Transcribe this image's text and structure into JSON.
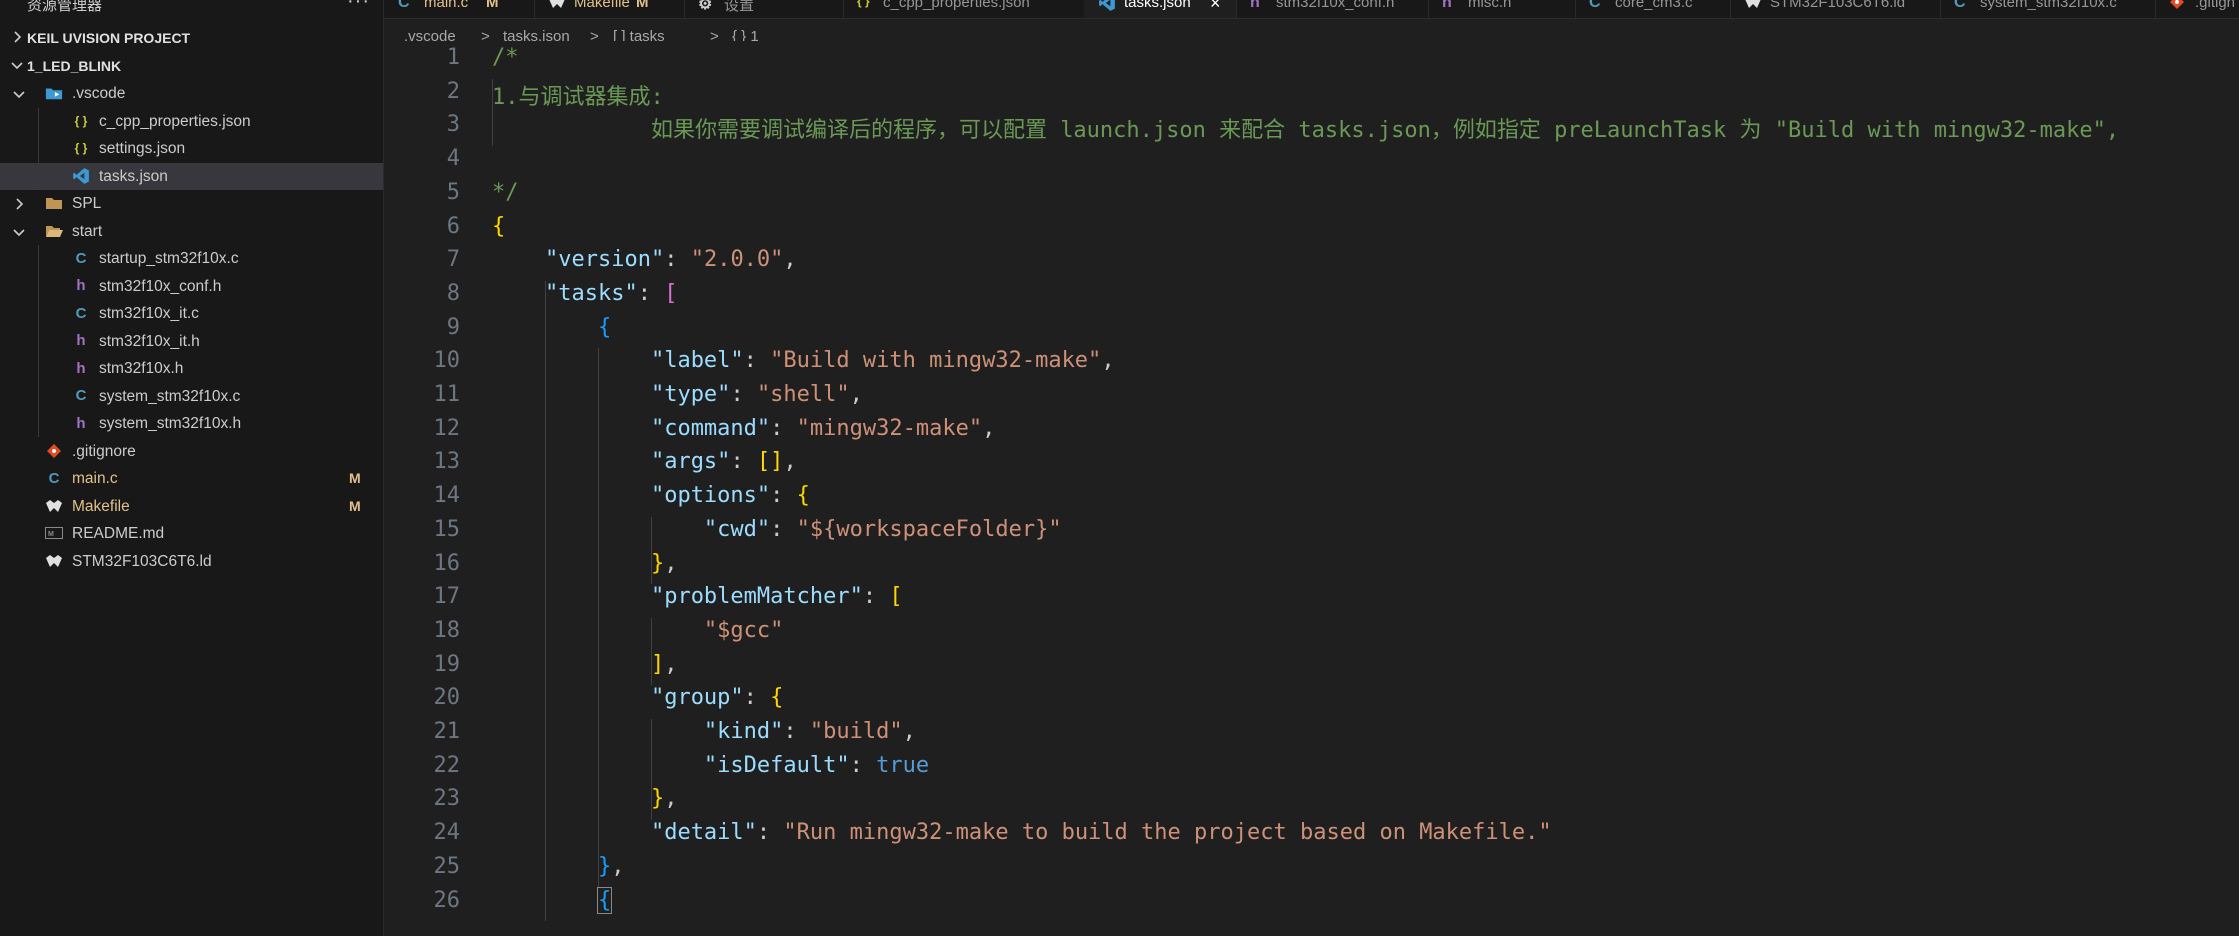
{
  "sidebar": {
    "header": "资源管理器",
    "more": "···",
    "section_collapsed": "KEIL UVISION PROJECT",
    "section_open": "1_LED_BLINK",
    "items": [
      {
        "label": ".vscode",
        "icon": "vscode-folder-icon",
        "depth": 1,
        "chev": "down"
      },
      {
        "label": "c_cpp_properties.json",
        "icon": "json-icon",
        "depth": 2
      },
      {
        "label": "settings.json",
        "icon": "json-icon",
        "depth": 2
      },
      {
        "label": "tasks.json",
        "icon": "vscode-file-icon",
        "depth": 2,
        "selected": true
      },
      {
        "label": "SPL",
        "icon": "folder-icon",
        "depth": 1,
        "chev": "right"
      },
      {
        "label": "start",
        "icon": "folder-open-icon",
        "depth": 1,
        "chev": "down"
      },
      {
        "label": "startup_stm32f10x.c",
        "icon": "c-file-icon",
        "depth": 2
      },
      {
        "label": "stm32f10x_conf.h",
        "icon": "h-file-icon",
        "depth": 2
      },
      {
        "label": "stm32f10x_it.c",
        "icon": "c-file-icon",
        "depth": 2
      },
      {
        "label": "stm32f10x_it.h",
        "icon": "h-file-icon",
        "depth": 2
      },
      {
        "label": "stm32f10x.h",
        "icon": "h-file-icon",
        "depth": 2
      },
      {
        "label": "system_stm32f10x.c",
        "icon": "c-file-icon",
        "depth": 2
      },
      {
        "label": "system_stm32f10x.h",
        "icon": "h-file-icon",
        "depth": 2
      },
      {
        "label": ".gitignore",
        "icon": "git-icon",
        "depth": 1
      },
      {
        "label": "main.c",
        "icon": "c-file-icon",
        "depth": 1,
        "badge": "M",
        "modified": true
      },
      {
        "label": "Makefile",
        "icon": "makefile-icon",
        "depth": 1,
        "badge": "M",
        "modified": true
      },
      {
        "label": "README.md",
        "icon": "markdown-icon",
        "depth": 1
      },
      {
        "label": "STM32F103C6T6.ld",
        "icon": "linker-icon",
        "depth": 1
      }
    ]
  },
  "tabs": [
    {
      "label": "main.c",
      "icon": "c-file-icon",
      "mod": "M"
    },
    {
      "label": "Makefile",
      "icon": "makefile-icon",
      "mod": "M"
    },
    {
      "label": "设置",
      "icon": "settings-icon"
    },
    {
      "label": "c_cpp_properties.json",
      "icon": "json-icon"
    },
    {
      "label": "tasks.json",
      "icon": "vscode-file-icon",
      "active": true,
      "close": "×"
    },
    {
      "label": "stm32f10x_conf.h",
      "icon": "h-file-icon"
    },
    {
      "label": "misc.h",
      "icon": "h-file-icon"
    },
    {
      "label": "core_cm3.c",
      "icon": "c-file-icon"
    },
    {
      "label": "STM32F103C6T6.ld",
      "icon": "linker-icon"
    },
    {
      "label": "system_stm32f10x.c",
      "icon": "c-file-icon"
    },
    {
      "label": ".gitign",
      "icon": "git-icon"
    }
  ],
  "breadcrumb": [
    ".vscode",
    ">",
    "tasks.json",
    ">",
    "[ ] tasks",
    ">",
    "{ } 1"
  ],
  "editor": {
    "lines": [
      {
        "n": "1",
        "tokens": [
          [
            "/*",
            "com"
          ]
        ]
      },
      {
        "n": "2",
        "tokens": [
          [
            "1.与调试器集成:",
            "com"
          ]
        ]
      },
      {
        "n": "3",
        "tokens": [
          [
            "            如果你需要调试编译后的程序，可以配置 launch.json 来配合 tasks.json，例如指定 preLaunchTask 为 \"Build with mingw32-make\",",
            "com"
          ]
        ]
      },
      {
        "n": "4",
        "tokens": []
      },
      {
        "n": "5",
        "tokens": [
          [
            "*/",
            "com"
          ]
        ]
      },
      {
        "n": "6",
        "tokens": [
          [
            "{",
            "b1"
          ]
        ]
      },
      {
        "n": "7",
        "tokens": [
          [
            "    ",
            "pun"
          ],
          [
            "\"version\"",
            "key"
          ],
          [
            ": ",
            "pun"
          ],
          [
            "\"2.0.0\"",
            "str"
          ],
          [
            ",",
            "pun"
          ]
        ]
      },
      {
        "n": "8",
        "tokens": [
          [
            "    ",
            "pun"
          ],
          [
            "\"tasks\"",
            "key"
          ],
          [
            ": ",
            "pun"
          ],
          [
            "[",
            "b2"
          ]
        ]
      },
      {
        "n": "9",
        "tokens": [
          [
            "        ",
            "pun"
          ],
          [
            "{",
            "b3"
          ]
        ]
      },
      {
        "n": "10",
        "tokens": [
          [
            "            ",
            "pun"
          ],
          [
            "\"label\"",
            "key"
          ],
          [
            ": ",
            "pun"
          ],
          [
            "\"Build with mingw32-make\"",
            "str"
          ],
          [
            ",",
            "pun"
          ]
        ]
      },
      {
        "n": "11",
        "tokens": [
          [
            "            ",
            "pun"
          ],
          [
            "\"type\"",
            "key"
          ],
          [
            ": ",
            "pun"
          ],
          [
            "\"shell\"",
            "str"
          ],
          [
            ",",
            "pun"
          ]
        ]
      },
      {
        "n": "12",
        "tokens": [
          [
            "            ",
            "pun"
          ],
          [
            "\"command\"",
            "key"
          ],
          [
            ": ",
            "pun"
          ],
          [
            "\"mingw32-make\"",
            "str"
          ],
          [
            ",",
            "pun"
          ]
        ]
      },
      {
        "n": "13",
        "tokens": [
          [
            "            ",
            "pun"
          ],
          [
            "\"args\"",
            "key"
          ],
          [
            ": ",
            "pun"
          ],
          [
            "[]",
            "b1"
          ],
          [
            ",",
            "pun"
          ]
        ]
      },
      {
        "n": "14",
        "tokens": [
          [
            "            ",
            "pun"
          ],
          [
            "\"options\"",
            "key"
          ],
          [
            ": ",
            "pun"
          ],
          [
            "{",
            "b1"
          ]
        ]
      },
      {
        "n": "15",
        "tokens": [
          [
            "                ",
            "pun"
          ],
          [
            "\"cwd\"",
            "key"
          ],
          [
            ": ",
            "pun"
          ],
          [
            "\"${workspaceFolder}\"",
            "str"
          ]
        ]
      },
      {
        "n": "16",
        "tokens": [
          [
            "            ",
            "pun"
          ],
          [
            "}",
            "b1"
          ],
          [
            ",",
            "pun"
          ]
        ]
      },
      {
        "n": "17",
        "tokens": [
          [
            "            ",
            "pun"
          ],
          [
            "\"problemMatcher\"",
            "key"
          ],
          [
            ": ",
            "pun"
          ],
          [
            "[",
            "b1"
          ]
        ]
      },
      {
        "n": "18",
        "tokens": [
          [
            "                ",
            "pun"
          ],
          [
            "\"$gcc\"",
            "str"
          ]
        ]
      },
      {
        "n": "19",
        "tokens": [
          [
            "            ",
            "pun"
          ],
          [
            "]",
            "b1"
          ],
          [
            ",",
            "pun"
          ]
        ]
      },
      {
        "n": "20",
        "tokens": [
          [
            "            ",
            "pun"
          ],
          [
            "\"group\"",
            "key"
          ],
          [
            ": ",
            "pun"
          ],
          [
            "{",
            "b1"
          ]
        ]
      },
      {
        "n": "21",
        "tokens": [
          [
            "                ",
            "pun"
          ],
          [
            "\"kind\"",
            "key"
          ],
          [
            ": ",
            "pun"
          ],
          [
            "\"build\"",
            "str"
          ],
          [
            ",",
            "pun"
          ]
        ]
      },
      {
        "n": "22",
        "tokens": [
          [
            "                ",
            "pun"
          ],
          [
            "\"isDefault\"",
            "key"
          ],
          [
            ": ",
            "pun"
          ],
          [
            "true",
            "bool"
          ]
        ]
      },
      {
        "n": "23",
        "tokens": [
          [
            "            ",
            "pun"
          ],
          [
            "}",
            "b1"
          ],
          [
            ",",
            "pun"
          ]
        ]
      },
      {
        "n": "24",
        "tokens": [
          [
            "            ",
            "pun"
          ],
          [
            "\"detail\"",
            "key"
          ],
          [
            ": ",
            "pun"
          ],
          [
            "\"Run mingw32-make to build the project based on Makefile.\"",
            "str"
          ]
        ]
      },
      {
        "n": "25",
        "tokens": [
          [
            "        ",
            "pun"
          ],
          [
            "}",
            "b3"
          ],
          [
            ",",
            "pun"
          ]
        ]
      },
      {
        "n": "26",
        "tokens": [
          [
            "        ",
            "pun"
          ],
          [
            "{",
            "b3"
          ]
        ]
      }
    ]
  },
  "colors": {
    "background": "#1f1f1f",
    "sidebar": "#181818",
    "comment": "#6a9955",
    "key": "#9cdcfe",
    "string": "#ce9178",
    "modified": "#e2c08d"
  }
}
